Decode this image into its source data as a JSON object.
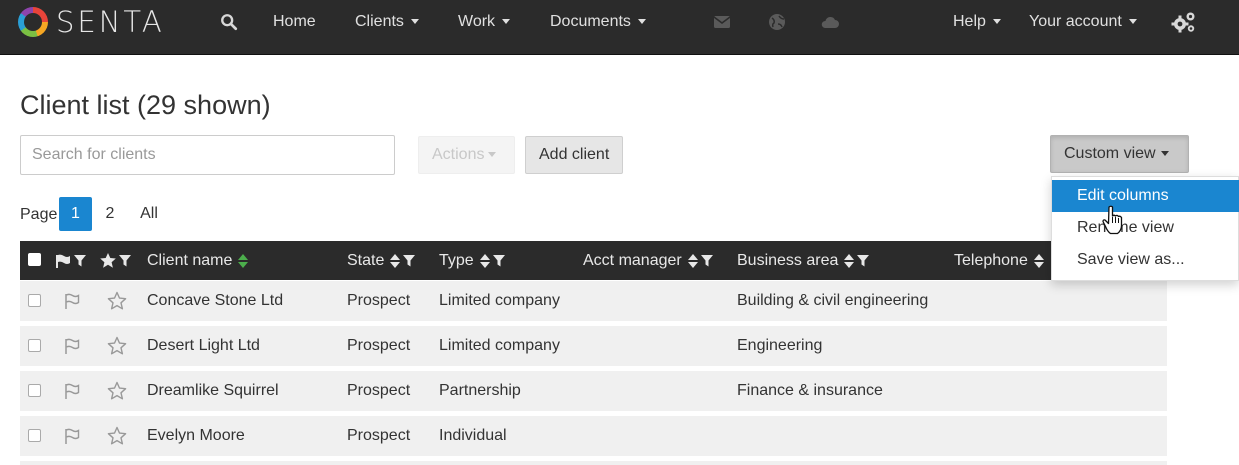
{
  "app": {
    "brand": "SENTA",
    "colors": {
      "navbar": "#2b2b2b",
      "accent": "#1a86d0",
      "row": "#f0f0f0"
    }
  },
  "nav": {
    "home": "Home",
    "clients": "Clients",
    "work": "Work",
    "documents": "Documents",
    "help": "Help",
    "account": "Your account",
    "icons": [
      "search-icon",
      "mail-icon",
      "globe-icon",
      "cloud-icon",
      "gears-icon"
    ]
  },
  "page": {
    "title": "Client list (29 shown)"
  },
  "toolbar": {
    "search_placeholder": "Search for clients",
    "actions_label": "Actions",
    "add_client_label": "Add client",
    "custom_view_label": "Custom view"
  },
  "custom_view_menu": {
    "items": [
      "Edit columns",
      "Rename view",
      "Save view as..."
    ],
    "active_index": 0
  },
  "pagination": {
    "label": "Page",
    "pages": [
      "1",
      "2",
      "All"
    ],
    "current": "1"
  },
  "table": {
    "columns": {
      "client_name": "Client name",
      "state": "State",
      "type": "Type",
      "acct_manager": "Acct manager",
      "business_area": "Business area",
      "telephone": "Telephone"
    },
    "rows": [
      {
        "name": "Concave Stone Ltd",
        "state": "Prospect",
        "type": "Limited company",
        "business_area": "Building & civil engineering"
      },
      {
        "name": "Desert Light Ltd",
        "state": "Prospect",
        "type": "Limited company",
        "business_area": "Engineering"
      },
      {
        "name": "Dreamlike Squirrel",
        "state": "Prospect",
        "type": "Partnership",
        "business_area": "Finance & insurance"
      },
      {
        "name": "Evelyn Moore",
        "state": "Prospect",
        "type": "Individual",
        "business_area": ""
      }
    ]
  }
}
